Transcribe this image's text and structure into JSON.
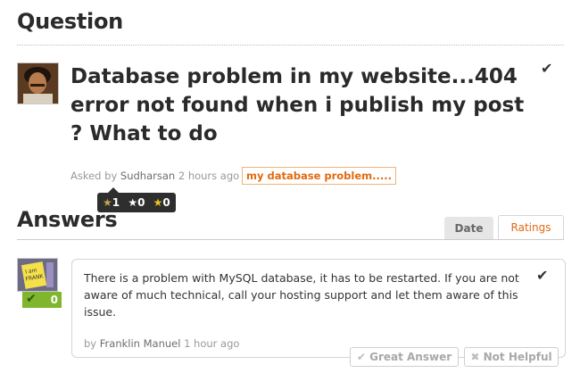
{
  "question_section": {
    "heading": "Question"
  },
  "question": {
    "title": "Database problem in my website...404 error not found when i publish my post ? What to do",
    "asked_by_label": "Asked by",
    "author": "Sudharsan",
    "time_ago": "2 hours ago",
    "tag": "my database problem.....",
    "check_glyph": "✔"
  },
  "rating_badge": {
    "gold_star": "★",
    "gold_count": "1",
    "white_star": "★",
    "white_count": "0",
    "yellow_star": "★",
    "yellow_count": "0"
  },
  "answers_section": {
    "heading": "Answers",
    "tabs": [
      {
        "label": "Date"
      },
      {
        "label": "Ratings"
      }
    ]
  },
  "answer": {
    "text": "There is a problem with MySQL database, it has to be restarted. If you are not aware of much technical, call your hosting support and let them aware of this issue.",
    "by_label": "by",
    "author": "Franklin Manuel",
    "time_ago": "1 hour ago",
    "check_glyph": "✔",
    "vote_count": "0",
    "avatar_note_lines": [
      "I am",
      "FRANK"
    ],
    "actions": {
      "great_answer": "Great Answer",
      "not_helpful": "Not Helpful"
    }
  },
  "colors": {
    "accent_orange": "#e06a10",
    "vote_green": "#7fb62d",
    "badge_dark": "#2e2e2e"
  }
}
